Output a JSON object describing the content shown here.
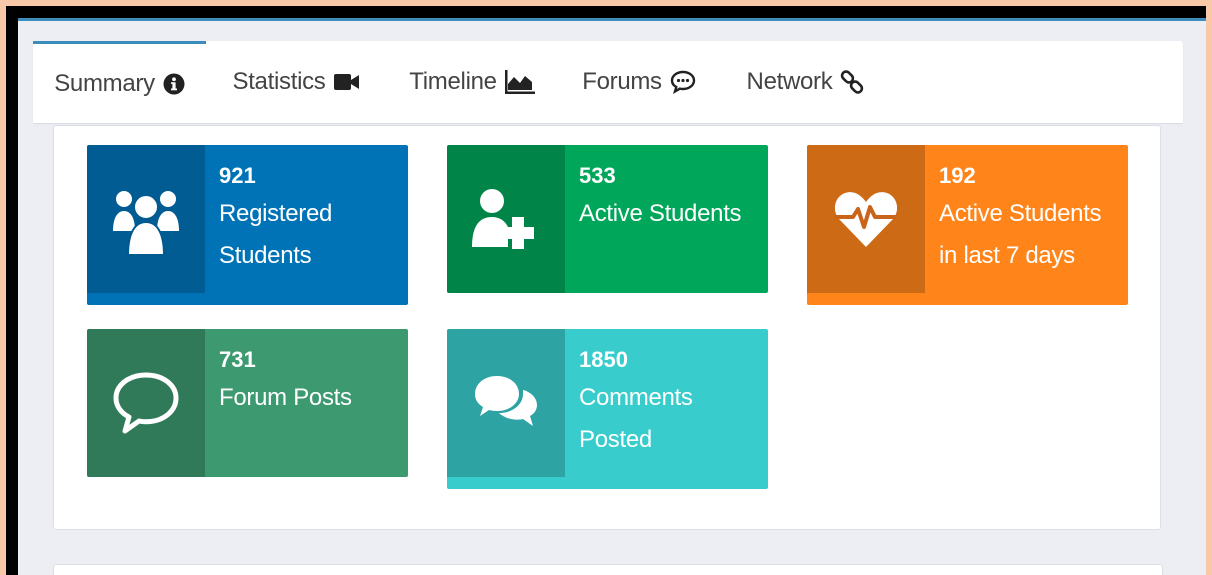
{
  "tabs": [
    {
      "label": "Summary",
      "icon": "info-circle-icon",
      "active": true
    },
    {
      "label": "Statistics",
      "icon": "video-camera-icon",
      "active": false
    },
    {
      "label": "Timeline",
      "icon": "area-chart-icon",
      "active": false
    },
    {
      "label": "Forums",
      "icon": "comment-dots-icon",
      "active": false
    },
    {
      "label": "Network",
      "icon": "link-icon",
      "active": false
    }
  ],
  "colors": {
    "blue": "#0073b7",
    "green": "#00a65a",
    "orange": "#ff851b",
    "forest": "#3d9970",
    "teal": "#39cccc"
  },
  "stats": [
    {
      "value": "921",
      "line1": "Registered",
      "line2": "Students",
      "icon": "users-icon",
      "color": "#0073b7"
    },
    {
      "value": "533",
      "line1": "Active Students",
      "line2": "",
      "icon": "user-plus-icon",
      "color": "#00a65a"
    },
    {
      "value": "192",
      "line1": "Active Students",
      "line2": "in last 7 days",
      "icon": "heartbeat-icon",
      "color": "#ff851b"
    },
    {
      "value": "731",
      "line1": "Forum Posts",
      "line2": "",
      "icon": "speech-bubble-icon",
      "color": "#3d9970"
    },
    {
      "value": "1850",
      "line1": "Comments",
      "line2": "Posted",
      "icon": "comments-icon",
      "color": "#39cccc"
    }
  ]
}
